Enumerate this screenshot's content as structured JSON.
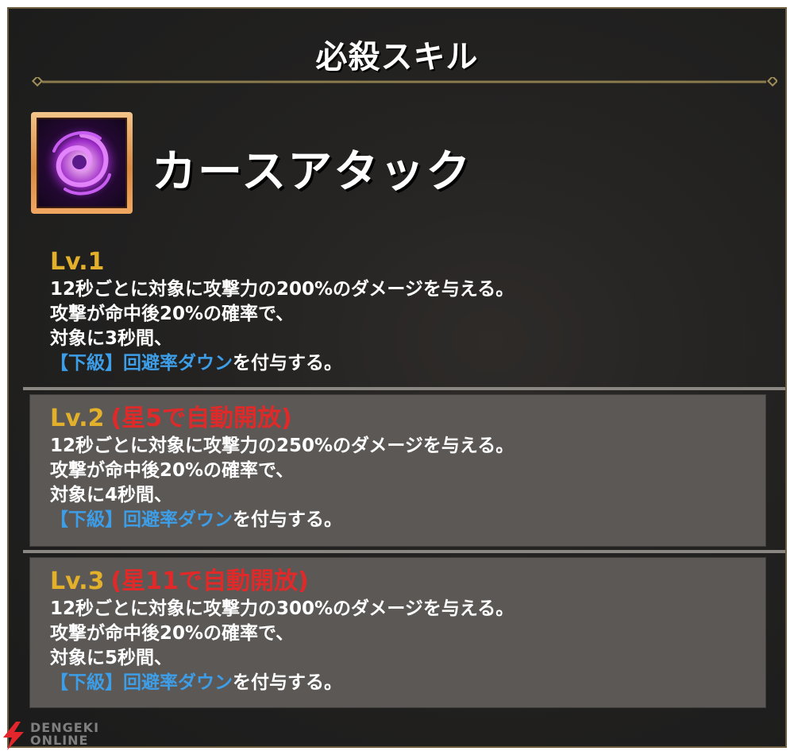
{
  "header": {
    "title": "必殺スキル"
  },
  "skill": {
    "name": "カースアタック",
    "icon": "curse-vortex-icon"
  },
  "levels": [
    {
      "label": "Lv.1",
      "unlock": "",
      "line1": "12秒ごとに対象に攻撃力の200%のダメージを与える。",
      "line2": "攻撃が命中後20%の確率で、",
      "line3": "対象に3秒間、",
      "status": "【下級】回避率ダウン",
      "suffix": "を付与する。"
    },
    {
      "label": "Lv.2",
      "unlock": "(星5で自動開放)",
      "line1": "12秒ごとに対象に攻撃力の250%のダメージを与える。",
      "line2": "攻撃が命中後20%の確率で、",
      "line3": "対象に4秒間、",
      "status": "【下級】回避率ダウン",
      "suffix": "を付与する。"
    },
    {
      "label": "Lv.3",
      "unlock": "(星11で自動開放)",
      "line1": "12秒ごとに対象に攻撃力の300%のダメージを与える。",
      "line2": "攻撃が命中後20%の確率で、",
      "line3": "対象に5秒間、",
      "status": "【下級】回避率ダウン",
      "suffix": "を付与する。"
    }
  ],
  "watermark": {
    "line1": "DENGEKI",
    "line2": "ONLINE"
  },
  "colors": {
    "level_label": "#e2b02a",
    "unlock_text": "#e02a2a",
    "status_effect": "#3d9de6",
    "locked_bg": "#5b5856"
  }
}
